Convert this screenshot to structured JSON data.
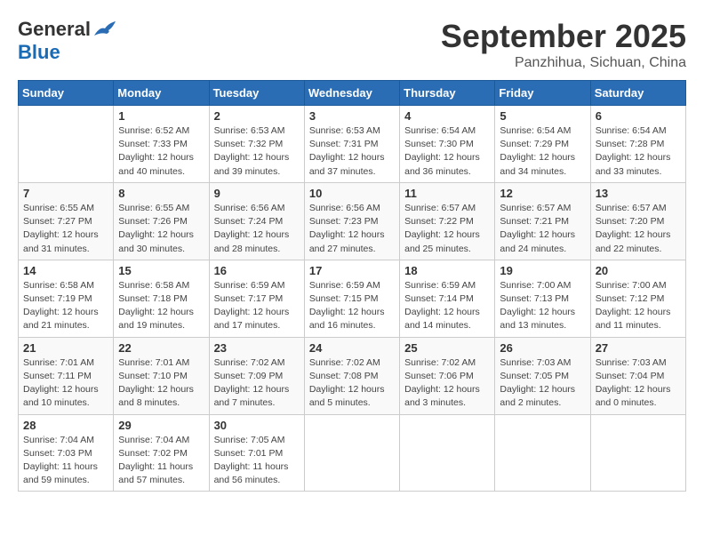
{
  "logo": {
    "general": "General",
    "blue": "Blue"
  },
  "header": {
    "month": "September 2025",
    "location": "Panzhihua, Sichuan, China"
  },
  "weekdays": [
    "Sunday",
    "Monday",
    "Tuesday",
    "Wednesday",
    "Thursday",
    "Friday",
    "Saturday"
  ],
  "weeks": [
    [
      {
        "day": "",
        "info": ""
      },
      {
        "day": "1",
        "info": "Sunrise: 6:52 AM\nSunset: 7:33 PM\nDaylight: 12 hours\nand 40 minutes."
      },
      {
        "day": "2",
        "info": "Sunrise: 6:53 AM\nSunset: 7:32 PM\nDaylight: 12 hours\nand 39 minutes."
      },
      {
        "day": "3",
        "info": "Sunrise: 6:53 AM\nSunset: 7:31 PM\nDaylight: 12 hours\nand 37 minutes."
      },
      {
        "day": "4",
        "info": "Sunrise: 6:54 AM\nSunset: 7:30 PM\nDaylight: 12 hours\nand 36 minutes."
      },
      {
        "day": "5",
        "info": "Sunrise: 6:54 AM\nSunset: 7:29 PM\nDaylight: 12 hours\nand 34 minutes."
      },
      {
        "day": "6",
        "info": "Sunrise: 6:54 AM\nSunset: 7:28 PM\nDaylight: 12 hours\nand 33 minutes."
      }
    ],
    [
      {
        "day": "7",
        "info": "Sunrise: 6:55 AM\nSunset: 7:27 PM\nDaylight: 12 hours\nand 31 minutes."
      },
      {
        "day": "8",
        "info": "Sunrise: 6:55 AM\nSunset: 7:26 PM\nDaylight: 12 hours\nand 30 minutes."
      },
      {
        "day": "9",
        "info": "Sunrise: 6:56 AM\nSunset: 7:24 PM\nDaylight: 12 hours\nand 28 minutes."
      },
      {
        "day": "10",
        "info": "Sunrise: 6:56 AM\nSunset: 7:23 PM\nDaylight: 12 hours\nand 27 minutes."
      },
      {
        "day": "11",
        "info": "Sunrise: 6:57 AM\nSunset: 7:22 PM\nDaylight: 12 hours\nand 25 minutes."
      },
      {
        "day": "12",
        "info": "Sunrise: 6:57 AM\nSunset: 7:21 PM\nDaylight: 12 hours\nand 24 minutes."
      },
      {
        "day": "13",
        "info": "Sunrise: 6:57 AM\nSunset: 7:20 PM\nDaylight: 12 hours\nand 22 minutes."
      }
    ],
    [
      {
        "day": "14",
        "info": "Sunrise: 6:58 AM\nSunset: 7:19 PM\nDaylight: 12 hours\nand 21 minutes."
      },
      {
        "day": "15",
        "info": "Sunrise: 6:58 AM\nSunset: 7:18 PM\nDaylight: 12 hours\nand 19 minutes."
      },
      {
        "day": "16",
        "info": "Sunrise: 6:59 AM\nSunset: 7:17 PM\nDaylight: 12 hours\nand 17 minutes."
      },
      {
        "day": "17",
        "info": "Sunrise: 6:59 AM\nSunset: 7:15 PM\nDaylight: 12 hours\nand 16 minutes."
      },
      {
        "day": "18",
        "info": "Sunrise: 6:59 AM\nSunset: 7:14 PM\nDaylight: 12 hours\nand 14 minutes."
      },
      {
        "day": "19",
        "info": "Sunrise: 7:00 AM\nSunset: 7:13 PM\nDaylight: 12 hours\nand 13 minutes."
      },
      {
        "day": "20",
        "info": "Sunrise: 7:00 AM\nSunset: 7:12 PM\nDaylight: 12 hours\nand 11 minutes."
      }
    ],
    [
      {
        "day": "21",
        "info": "Sunrise: 7:01 AM\nSunset: 7:11 PM\nDaylight: 12 hours\nand 10 minutes."
      },
      {
        "day": "22",
        "info": "Sunrise: 7:01 AM\nSunset: 7:10 PM\nDaylight: 12 hours\nand 8 minutes."
      },
      {
        "day": "23",
        "info": "Sunrise: 7:02 AM\nSunset: 7:09 PM\nDaylight: 12 hours\nand 7 minutes."
      },
      {
        "day": "24",
        "info": "Sunrise: 7:02 AM\nSunset: 7:08 PM\nDaylight: 12 hours\nand 5 minutes."
      },
      {
        "day": "25",
        "info": "Sunrise: 7:02 AM\nSunset: 7:06 PM\nDaylight: 12 hours\nand 3 minutes."
      },
      {
        "day": "26",
        "info": "Sunrise: 7:03 AM\nSunset: 7:05 PM\nDaylight: 12 hours\nand 2 minutes."
      },
      {
        "day": "27",
        "info": "Sunrise: 7:03 AM\nSunset: 7:04 PM\nDaylight: 12 hours\nand 0 minutes."
      }
    ],
    [
      {
        "day": "28",
        "info": "Sunrise: 7:04 AM\nSunset: 7:03 PM\nDaylight: 11 hours\nand 59 minutes."
      },
      {
        "day": "29",
        "info": "Sunrise: 7:04 AM\nSunset: 7:02 PM\nDaylight: 11 hours\nand 57 minutes."
      },
      {
        "day": "30",
        "info": "Sunrise: 7:05 AM\nSunset: 7:01 PM\nDaylight: 11 hours\nand 56 minutes."
      },
      {
        "day": "",
        "info": ""
      },
      {
        "day": "",
        "info": ""
      },
      {
        "day": "",
        "info": ""
      },
      {
        "day": "",
        "info": ""
      }
    ]
  ]
}
